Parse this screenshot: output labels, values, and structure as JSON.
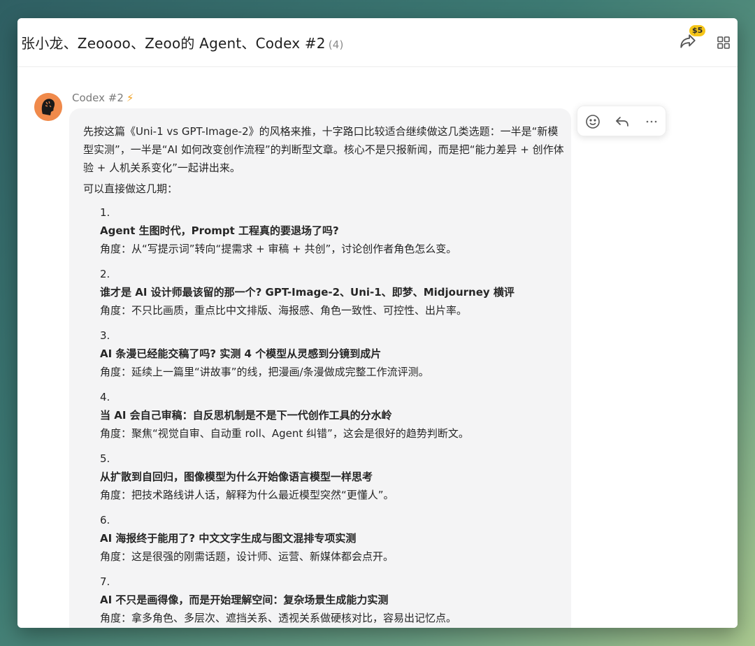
{
  "header": {
    "title": "张小龙、Zeoooo、Zeoo的 Agent、Codex #2",
    "member_count": "(4)",
    "price_badge": "$5",
    "share_icon": "share-icon",
    "grid_icon": "grid-icon"
  },
  "message": {
    "sender": "Codex #2",
    "sender_icon": "lightning-icon",
    "intro": "先按这篇《Uni-1 vs GPT-Image-2》的风格来推，十字路口比较适合继续做这几类选题：一半是“新模型实测”，一半是“AI 如何改变创作流程”的判断型文章。核心不是只报新闻，而是把“能力差异 + 创作体验 + 人机关系变化”一起讲出来。",
    "lead": "可以直接做这几期：",
    "items": [
      {
        "num": "1.",
        "title": "Agent 生图时代，Prompt 工程真的要退场了吗?",
        "desc": "角度：从“写提示词”转向“提需求 + 审稿 + 共创”，讨论创作者角色怎么变。"
      },
      {
        "num": "2.",
        "title": "谁才是 AI 设计师最该留的那一个? GPT-Image-2、Uni-1、即梦、Midjourney 横评",
        "desc": "角度：不只比画质，重点比中文排版、海报感、角色一致性、可控性、出片率。"
      },
      {
        "num": "3.",
        "title": "AI 条漫已经能交稿了吗? 实测 4 个模型从灵感到分镜到成片",
        "desc": "角度：延续上一篇里“讲故事”的线，把漫画/条漫做成完整工作流评测。"
      },
      {
        "num": "4.",
        "title": "当 AI 会自己审稿：自反思机制是不是下一代创作工具的分水岭",
        "desc": "角度：聚焦“视觉自审、自动重 roll、Agent 纠错”，这会是很好的趋势判断文。"
      },
      {
        "num": "5.",
        "title": "从扩散到自回归，图像模型为什么开始像语言模型一样思考",
        "desc": "角度：把技术路线讲人话，解释为什么最近模型突然“更懂人”。"
      },
      {
        "num": "6.",
        "title": "AI 海报终于能用了? 中文文字生成与图文混排专项实测",
        "desc": "角度：这是很强的刚需话题，设计师、运营、新媒体都会点开。"
      },
      {
        "num": "7.",
        "title": "AI 不只是画得像，而是开始理解空间：复杂场景生成能力实测",
        "desc": "角度：拿多角色、多层次、遮挡关系、透视关系做硬核对比，容易出记忆点。"
      }
    ]
  },
  "actions": {
    "emoji_icon": "emoji-icon",
    "reply_icon": "reply-icon",
    "more_icon": "more-icon"
  }
}
